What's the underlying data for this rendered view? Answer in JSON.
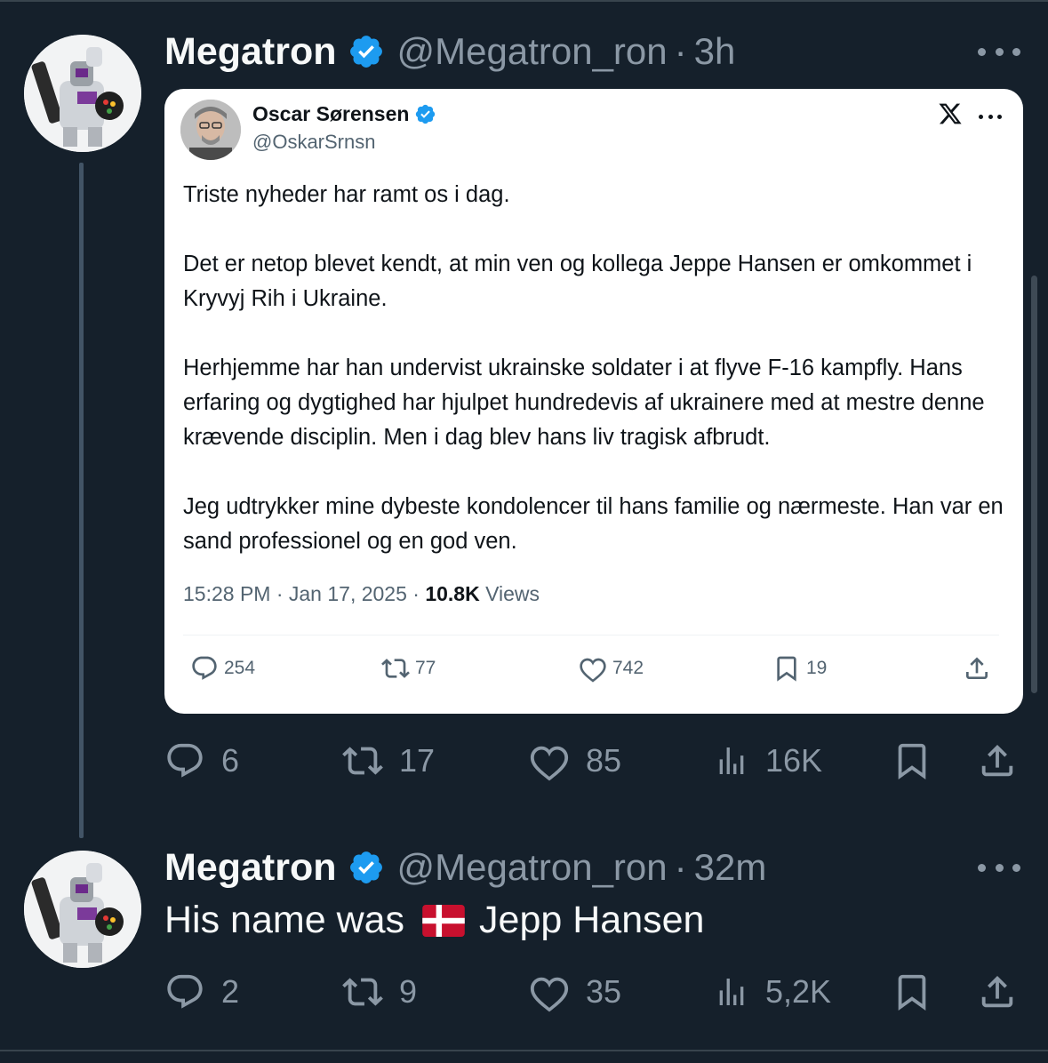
{
  "tweets": [
    {
      "author_name": "Megatron",
      "handle": "@Megatron_ron",
      "separator": "·",
      "time": "3h",
      "quoted": {
        "author_name": "Oscar Sørensen",
        "handle": "@OskarSrnsn",
        "paragraphs": [
          "Triste nyheder har ramt os i dag.",
          "Det er netop blevet kendt, at min ven og kollega Jeppe Hansen er omkommet i Kryvyj Rih i Ukraine.",
          "Herhjemme har han undervist ukrainske soldater i at flyve F-16 kampfly. Hans erfaring og dygtighed har hjulpet hundredevis af ukrainere med at mestre denne krævende disciplin. Men i dag blev hans liv tragisk afbrudt.",
          "Jeg udtrykker mine dybeste kondolencer til hans familie og nærmeste. Han var en sand professionel og en god ven."
        ],
        "timestamp": "15:28 PM · Jan 17, 2025 · ",
        "views_count": "10.8K",
        "views_label": " Views",
        "stats": {
          "replies": "254",
          "reposts": "77",
          "likes": "742",
          "bookmarks": "19"
        },
        "x_logo": "X"
      },
      "stats": {
        "replies": "6",
        "reposts": "17",
        "likes": "85",
        "views": "16K"
      }
    },
    {
      "author_name": "Megatron",
      "handle": "@Megatron_ron",
      "separator": "·",
      "time": "32m",
      "text_before": "His name was",
      "flag": "danish-flag",
      "text_after": "Jepp Hansen",
      "stats": {
        "replies": "2",
        "reposts": "9",
        "likes": "35",
        "views": "5,2K"
      }
    }
  ],
  "colors": {
    "background": "#15202b",
    "secondary_text": "#8b98a5",
    "verified_blue": "#1d9bf0",
    "flag_red": "#c8102e"
  }
}
